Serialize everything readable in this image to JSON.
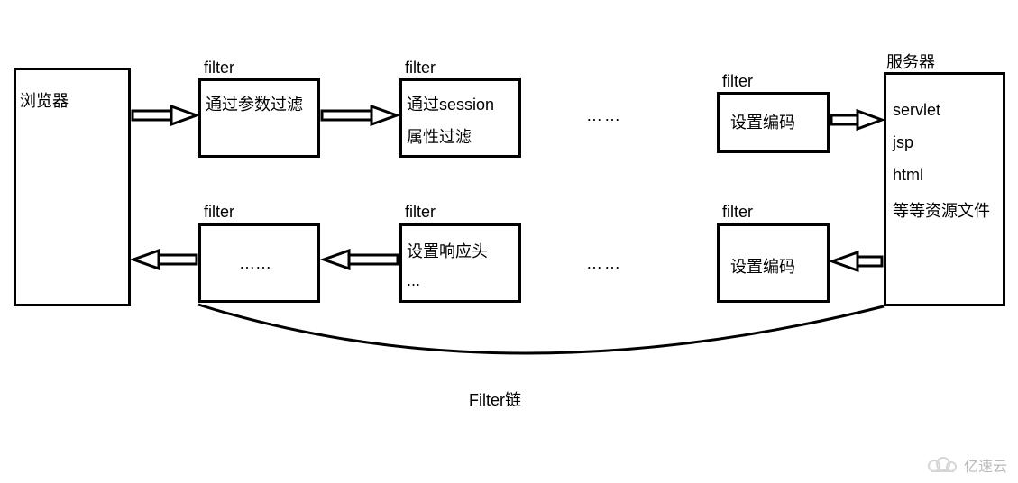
{
  "browser": {
    "label": "浏览器"
  },
  "server": {
    "title": "服务器",
    "lines": [
      "servlet",
      "jsp",
      "html",
      "等等资源文件"
    ]
  },
  "top_row": {
    "label": "filter",
    "box1": "通过参数过滤",
    "box2_line1": "通过session",
    "box2_line2": "属性过滤",
    "box3": "设置编码",
    "ellipsis": "……"
  },
  "bottom_row": {
    "label": "filter",
    "box1": "……",
    "box2_line1": "设置响应头",
    "box2_line2": "...",
    "box3": "设置编码",
    "ellipsis": "……"
  },
  "chain_label": "Filter链",
  "watermark": "亿速云"
}
